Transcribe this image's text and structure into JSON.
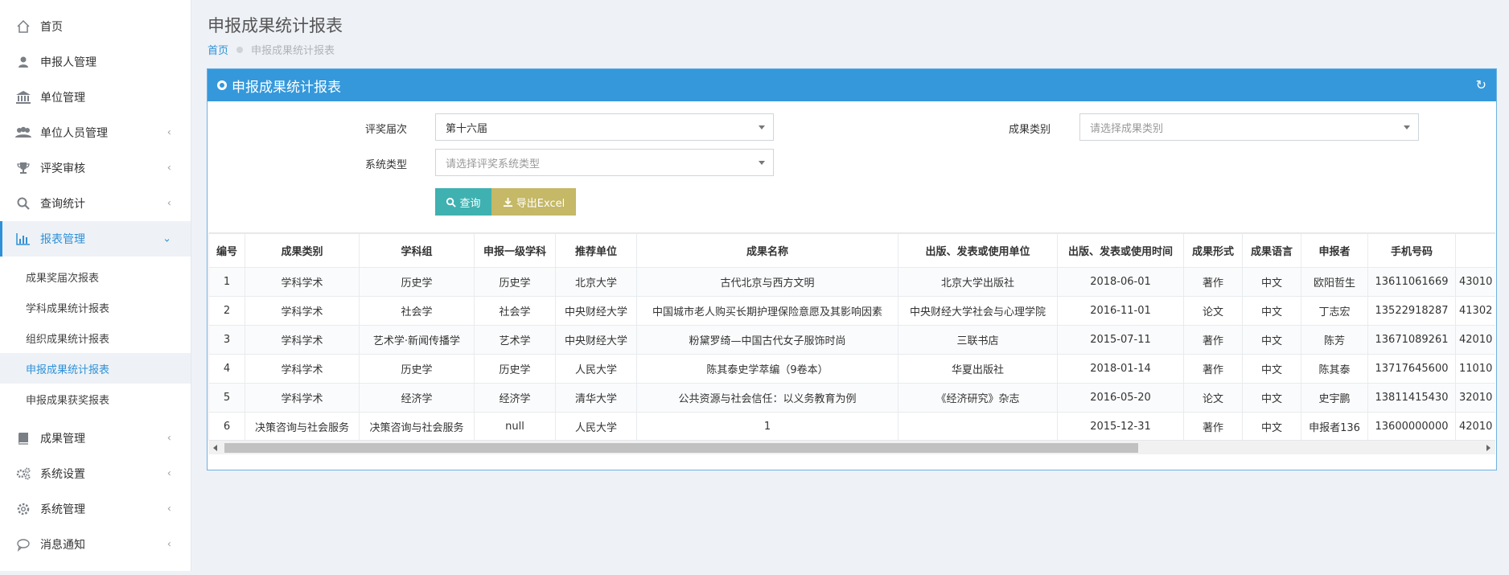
{
  "sidebar": {
    "items": [
      {
        "label": "首页",
        "icon": "home-icon"
      },
      {
        "label": "申报人管理",
        "icon": "user-icon"
      },
      {
        "label": "单位管理",
        "icon": "bank-icon"
      },
      {
        "label": "单位人员管理",
        "icon": "users-icon"
      },
      {
        "label": "评奖审核",
        "icon": "trophy-icon"
      },
      {
        "label": "查询统计",
        "icon": "search-icon"
      },
      {
        "label": "报表管理",
        "icon": "bar-chart-icon"
      },
      {
        "label": "成果管理",
        "icon": "book-icon"
      },
      {
        "label": "系统设置",
        "icon": "cogs-icon"
      },
      {
        "label": "系统管理",
        "icon": "gear-icon"
      },
      {
        "label": "消息通知",
        "icon": "comment-icon"
      }
    ],
    "report_sub": [
      {
        "label": "成果奖届次报表"
      },
      {
        "label": "学科成果统计报表"
      },
      {
        "label": "组织成果统计报表"
      },
      {
        "label": "申报成果统计报表"
      },
      {
        "label": "申报成果获奖报表"
      }
    ]
  },
  "header": {
    "title": "申报成果统计报表",
    "breadcrumb_home": "首页",
    "breadcrumb_current": "申报成果统计报表"
  },
  "panel": {
    "title": "申报成果统计报表",
    "award_label": "评奖届次",
    "award_value": "第十六届",
    "category_label": "成果类别",
    "category_placeholder": "请选择成果类别",
    "system_label": "系统类型",
    "system_placeholder": "请选择评奖系统类型",
    "query_label": "查询",
    "export_label": "导出Excel"
  },
  "table": {
    "headers": [
      "编号",
      "成果类别",
      "学科组",
      "申报一级学科",
      "推荐单位",
      "成果名称",
      "出版、发表或使用单位",
      "出版、发表或使用时间",
      "成果形式",
      "成果语言",
      "申报者",
      "手机号码",
      ""
    ],
    "rows": [
      [
        "1",
        "学科学术",
        "历史学",
        "历史学",
        "北京大学",
        "古代北京与西方文明",
        "北京大学出版社",
        "2018-06-01",
        "著作",
        "中文",
        "欧阳哲生",
        "13611061669",
        "43010"
      ],
      [
        "2",
        "学科学术",
        "社会学",
        "社会学",
        "中央财经大学",
        "中国城市老人购买长期护理保险意愿及其影响因素",
        "中央财经大学社会与心理学院",
        "2016-11-01",
        "论文",
        "中文",
        "丁志宏",
        "13522918287",
        "41302"
      ],
      [
        "3",
        "学科学术",
        "艺术学·新闻传播学",
        "艺术学",
        "中央财经大学",
        "粉黛罗绮—中国古代女子服饰时尚",
        "三联书店",
        "2015-07-11",
        "著作",
        "中文",
        "陈芳",
        "13671089261",
        "42010"
      ],
      [
        "4",
        "学科学术",
        "历史学",
        "历史学",
        "人民大学",
        "陈其泰史学萃编（9卷本）",
        "华夏出版社",
        "2018-01-14",
        "著作",
        "中文",
        "陈其泰",
        "13717645600",
        "11010"
      ],
      [
        "5",
        "学科学术",
        "经济学",
        "经济学",
        "清华大学",
        "公共资源与社会信任：以义务教育为例",
        "《经济研究》杂志",
        "2016-05-20",
        "论文",
        "中文",
        "史宇鹏",
        "13811415430",
        "32010"
      ],
      [
        "6",
        "决策咨询与社会服务",
        "决策咨询与社会服务",
        "null",
        "人民大学",
        "1",
        "",
        "2015-12-31",
        "著作",
        "中文",
        "申报者136",
        "13600000000",
        "42010"
      ]
    ]
  }
}
